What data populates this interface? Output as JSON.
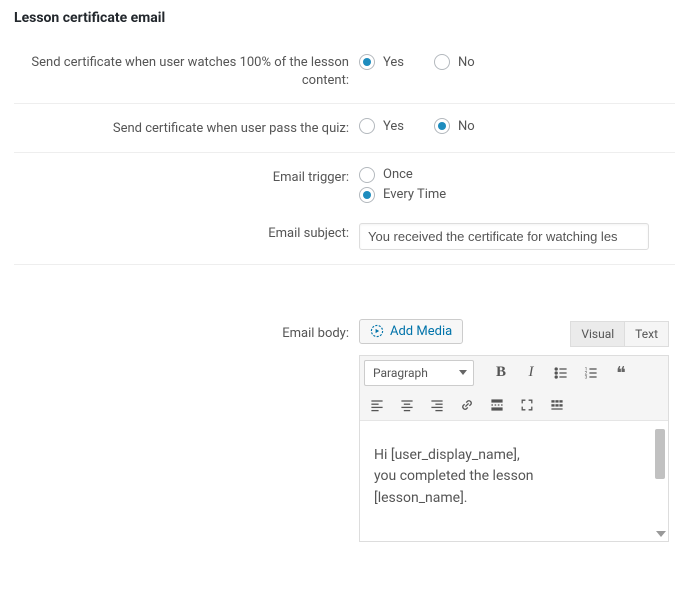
{
  "section_title": "Lesson certificate email",
  "rows": {
    "watch": {
      "label": "Send certificate when user watches 100% of the lesson content:",
      "yes": "Yes",
      "no": "No",
      "selected": "yes"
    },
    "quiz": {
      "label": "Send certificate when user pass the quiz:",
      "yes": "Yes",
      "no": "No",
      "selected": "no"
    },
    "trigger": {
      "label": "Email trigger:",
      "once": "Once",
      "every": "Every Time",
      "selected": "every"
    },
    "subject": {
      "label": "Email subject:",
      "value": "You received the certificate for watching les"
    },
    "body": {
      "label": "Email body:"
    }
  },
  "editor": {
    "add_media": "Add Media",
    "tab_visual": "Visual",
    "tab_text": "Text",
    "active_tab": "visual",
    "format_select": "Paragraph",
    "content_lines": {
      "l1": "Hi [user_display_name],",
      "l2": "you completed the lesson",
      "l3": "[lesson_name]."
    }
  }
}
